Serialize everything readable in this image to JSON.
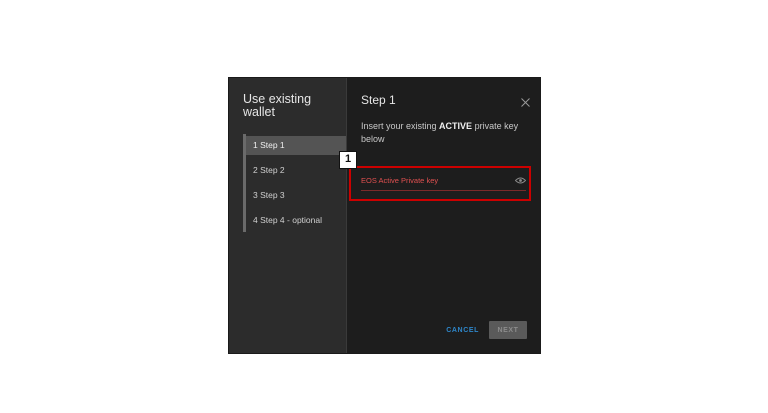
{
  "sidebar": {
    "title": "Use existing wallet",
    "steps": [
      {
        "label": "1  Step 1",
        "active": true
      },
      {
        "label": "2  Step 2",
        "active": false
      },
      {
        "label": "3  Step 3",
        "active": false
      },
      {
        "label": "4  Step 4 - optional",
        "active": false
      }
    ]
  },
  "content": {
    "title": "Step 1",
    "instruction_pre": "Insert your existing ",
    "instruction_bold": "ACTIVE",
    "instruction_post": " private key below",
    "field": {
      "placeholder": "EOS Active Private key",
      "value": ""
    },
    "actions": {
      "cancel_label": "CANCEL",
      "next_label": "NEXT"
    }
  },
  "annotation": {
    "marker_label": "1",
    "color": "#cc0000"
  },
  "icons": {
    "close": "close-icon",
    "eye": "eye-icon"
  },
  "colors": {
    "sidebar_bg": "#2c2c2c",
    "content_bg": "#1d1d1d",
    "active_step_bg": "#545454",
    "accent_blue": "#2e86c9",
    "error_red": "#e05050"
  }
}
